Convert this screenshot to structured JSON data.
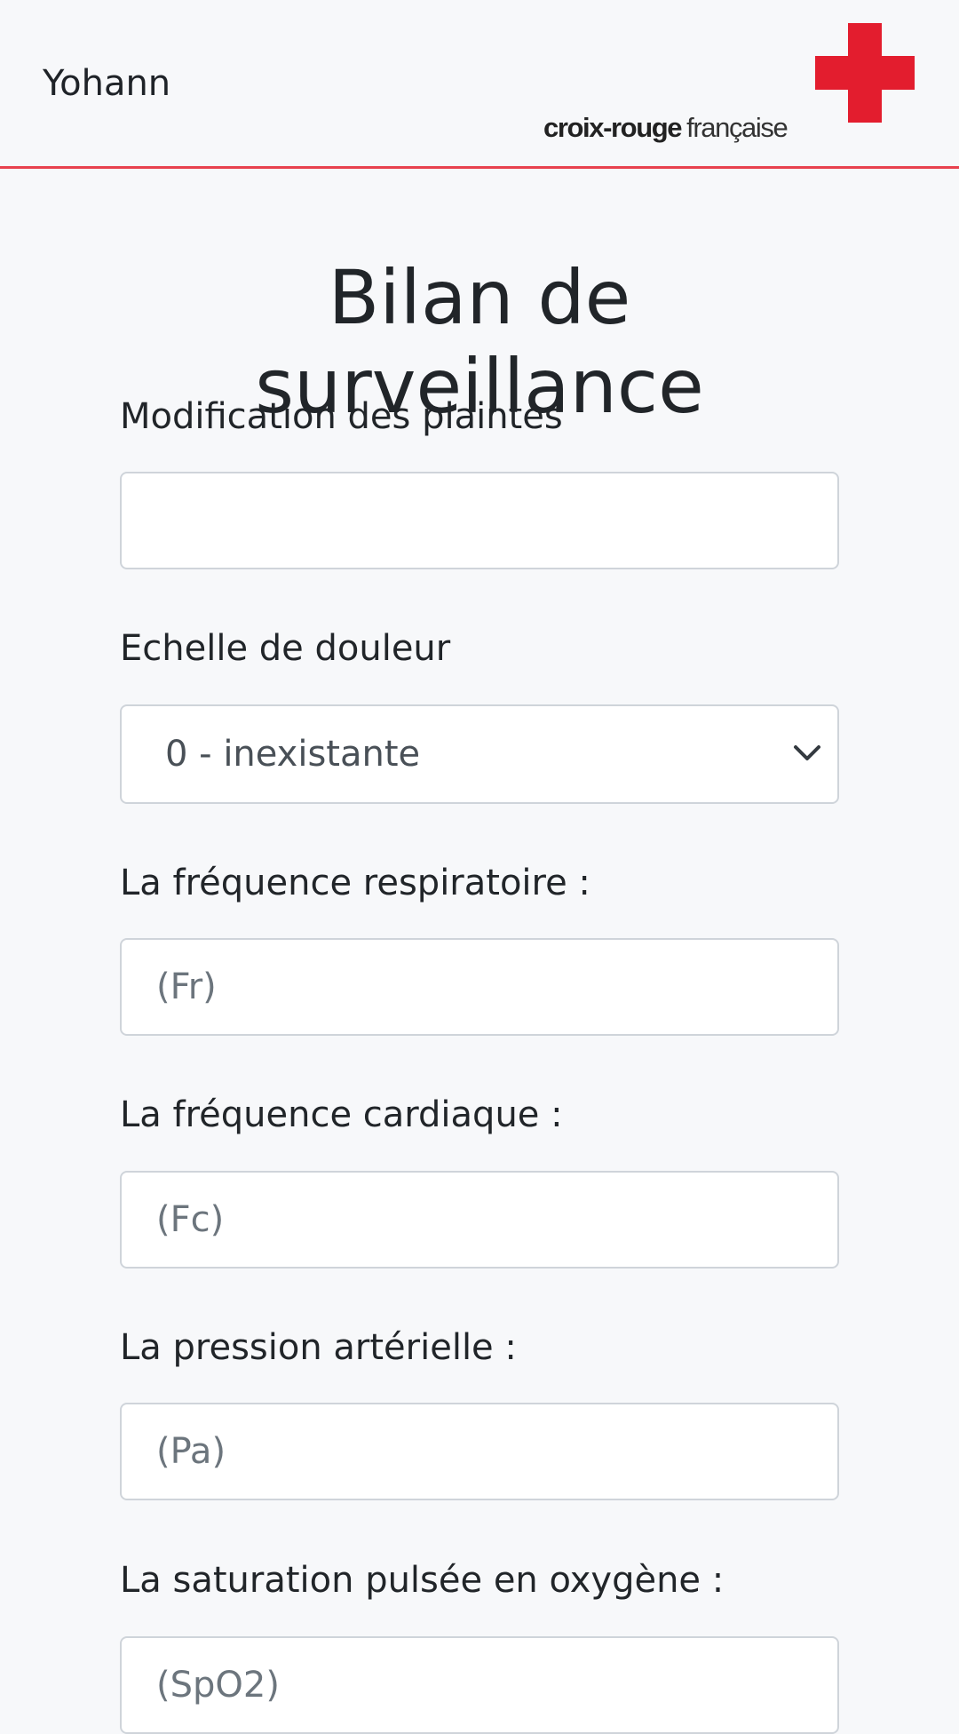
{
  "header": {
    "user_name": "Yohann",
    "brand": {
      "name_bold": "croix-rouge",
      "name_light": "française",
      "logo_icon": "red-cross-logo-icon",
      "brand_color": "#e31d2e",
      "header_border_color": "#e8414e"
    }
  },
  "form": {
    "title": "Bilan de surveillance",
    "fields": {
      "plaintes": {
        "label": "Modification des plaintes",
        "value": "",
        "placeholder": ""
      },
      "douleur": {
        "label": "Echelle de douleur",
        "selected": "0 - inexistante",
        "icon": "chevron-down-icon"
      },
      "fr": {
        "label": "La fréquence respiratoire :",
        "value": "",
        "placeholder": "(Fr)"
      },
      "fc": {
        "label": "La fréquence cardiaque :",
        "value": "",
        "placeholder": "(Fc)"
      },
      "pa": {
        "label": "La pression artérielle :",
        "value": "",
        "placeholder": "(Pa)"
      },
      "spo2": {
        "label": "La saturation pulsée en oxygène :",
        "value": "",
        "placeholder": "(SpO2)"
      }
    }
  }
}
